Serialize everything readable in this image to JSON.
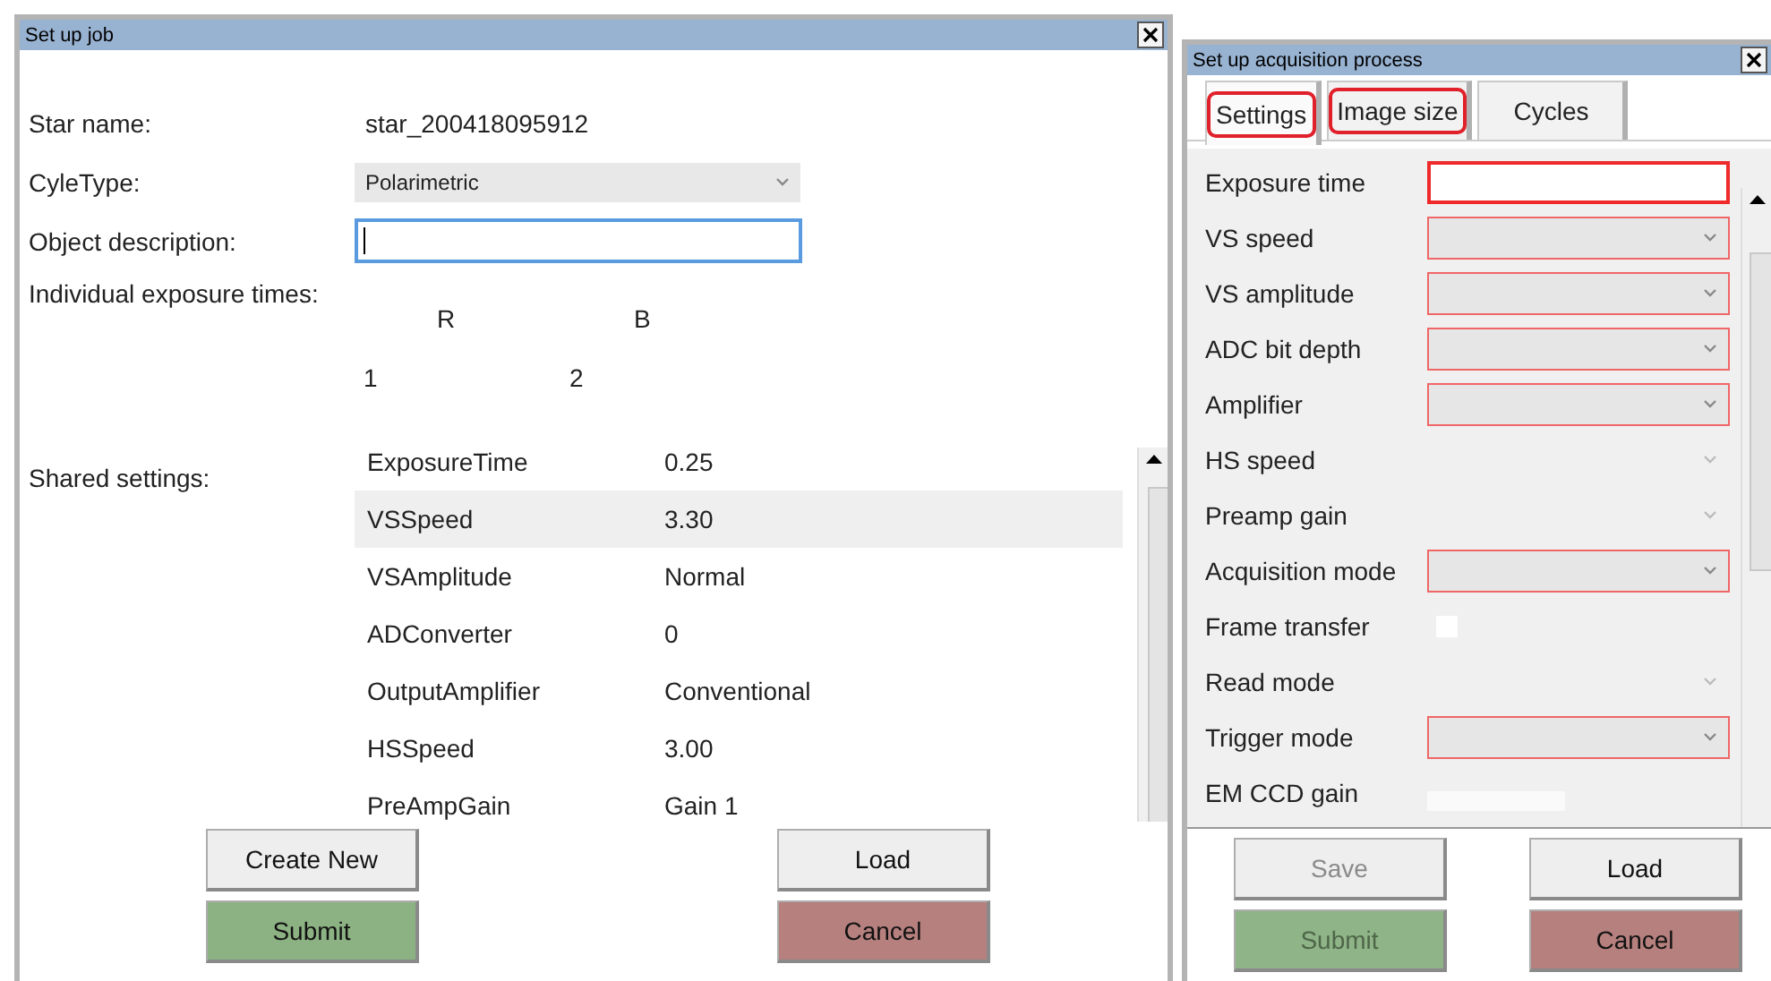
{
  "job_window": {
    "title": "Set up job",
    "fields": [
      {
        "kind": "text",
        "label": "Star name:",
        "value": "star_200418095912"
      },
      {
        "kind": "select",
        "label": "CyleType:",
        "value": "Polarimetric"
      },
      {
        "kind": "input",
        "label": "Object description:",
        "focused": true
      }
    ],
    "exposure": {
      "label": "Individual exposure times:",
      "filters": [
        "R",
        "B"
      ],
      "indexes": [
        "1",
        "2"
      ]
    },
    "shared": {
      "label": "Shared settings:",
      "rows": [
        {
          "name": "ExposureTime",
          "value": "0.25",
          "selected": false
        },
        {
          "name": "VSSpeed",
          "value": "3.30",
          "selected": true
        },
        {
          "name": "VSAmplitude",
          "value": "Normal",
          "selected": false
        },
        {
          "name": "ADConverter",
          "value": "0",
          "selected": false
        },
        {
          "name": "OutputAmplifier",
          "value": "Conventional",
          "selected": false
        },
        {
          "name": "HSSpeed",
          "value": "3.00",
          "selected": false
        },
        {
          "name": "PreAmpGain",
          "value": "Gain 1",
          "selected": false
        }
      ]
    },
    "buttons": [
      {
        "label": "Create New",
        "kind": "plain",
        "disabled": false
      },
      {
        "label": "Load",
        "kind": "plain",
        "disabled": false
      },
      {
        "label": "Submit",
        "kind": "submit",
        "disabled": false
      },
      {
        "label": "Cancel",
        "kind": "cancel",
        "disabled": false
      }
    ]
  },
  "acquisition_window": {
    "title": "Set up acquisition process",
    "tabs": [
      {
        "label": "Settings",
        "selected": true,
        "error": true
      },
      {
        "label": "Image size",
        "selected": false,
        "error": true
      },
      {
        "label": "Cycles",
        "selected": false,
        "error": false
      }
    ],
    "rows": [
      {
        "label": "Exposure time",
        "kind": "input",
        "error": true
      },
      {
        "label": "VS speed",
        "kind": "select",
        "error": true
      },
      {
        "label": "VS amplitude",
        "kind": "select",
        "error": true
      },
      {
        "label": "ADC bit depth",
        "kind": "select",
        "error": true
      },
      {
        "label": "Amplifier",
        "kind": "select",
        "error": true
      },
      {
        "label": "HS speed",
        "kind": "select",
        "error": false
      },
      {
        "label": "Preamp gain",
        "kind": "select",
        "error": false
      },
      {
        "label": "Acquisition mode",
        "kind": "select",
        "error": true
      },
      {
        "label": "Frame transfer",
        "kind": "checkbox",
        "checked": false
      },
      {
        "label": "Read mode",
        "kind": "select",
        "error": false
      },
      {
        "label": "Trigger mode",
        "kind": "select",
        "error": true
      },
      {
        "label": "EM CCD gain",
        "kind": "number",
        "error": false
      }
    ],
    "buttons": [
      {
        "label": "Save",
        "kind": "plain",
        "disabled": true
      },
      {
        "label": "Load",
        "kind": "plain",
        "disabled": false
      },
      {
        "label": "Submit",
        "kind": "submit",
        "disabled": true
      },
      {
        "label": "Cancel",
        "kind": "cancel",
        "disabled": false
      }
    ]
  }
}
